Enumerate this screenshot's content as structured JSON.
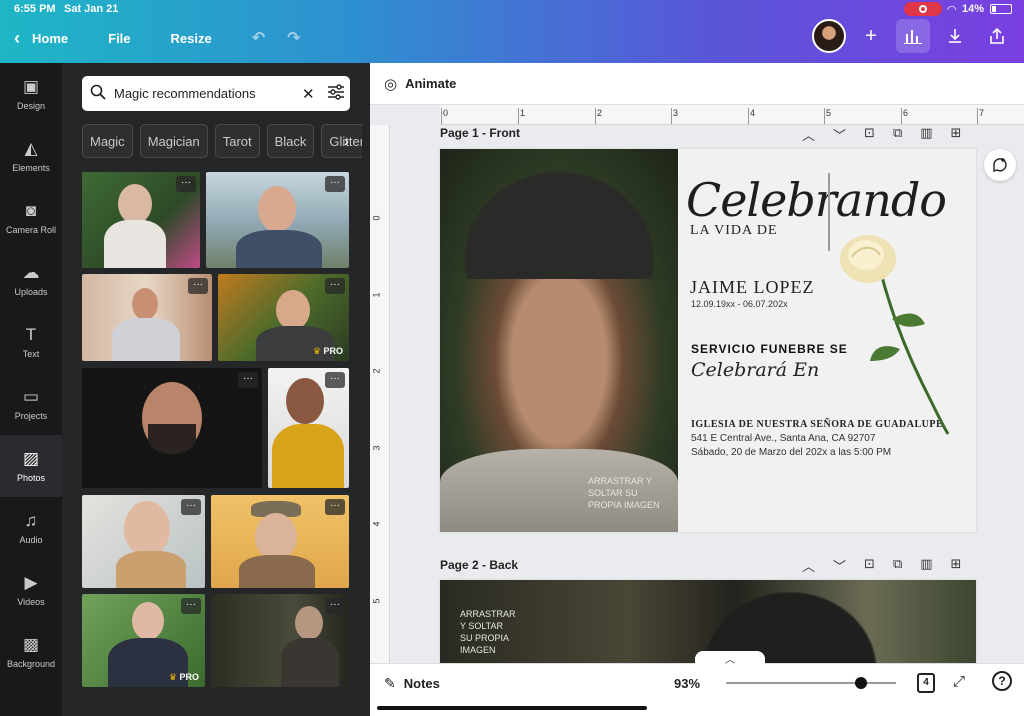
{
  "status": {
    "time": "6:55 PM",
    "date": "Sat Jan 21",
    "battery": "14%"
  },
  "nav": {
    "home": "Home",
    "file": "File",
    "resize": "Resize"
  },
  "rail": [
    {
      "label": "Design",
      "icon": "layout-icon"
    },
    {
      "label": "Elements",
      "icon": "shapes-icon"
    },
    {
      "label": "Camera Roll",
      "icon": "camera-icon"
    },
    {
      "label": "Uploads",
      "icon": "cloud-upload-icon"
    },
    {
      "label": "Text",
      "icon": "text-icon"
    },
    {
      "label": "Projects",
      "icon": "folder-icon"
    },
    {
      "label": "Photos",
      "icon": "image-icon"
    },
    {
      "label": "Audio",
      "icon": "music-icon"
    },
    {
      "label": "Videos",
      "icon": "video-icon"
    },
    {
      "label": "Background",
      "icon": "pattern-icon"
    }
  ],
  "search": {
    "value": "Magic recommendations"
  },
  "chips": [
    "Magic",
    "Magician",
    "Tarot",
    "Black",
    "Glitter"
  ],
  "thumb_badges": {
    "pro": "PRO"
  },
  "toolbar": {
    "animate": "Animate"
  },
  "ruler": {
    "h": [
      "0",
      "1",
      "2",
      "3",
      "4",
      "5",
      "6",
      "7"
    ],
    "v": [
      "0",
      "1",
      "2",
      "3",
      "4",
      "5"
    ]
  },
  "pages": [
    {
      "label": "Page 1 - Front"
    },
    {
      "label": "Page 2 - Back"
    }
  ],
  "card": {
    "celebrando": "Celebrando",
    "lavida": "LA VIDA DE",
    "name": "JAIME LOPEZ",
    "dates": "12.09.19xx - 06.07.202x",
    "service": "SERVICIO FUNEBRE SE",
    "celebrara": "Celebrará En",
    "church": "IGLESIA DE NUESTRA SEÑORA DE GUADALUPE",
    "address": "541 E Central Ave., Santa Ana, CA 92707",
    "when": "Sábado, 20 de Marzo del 202x a las 5:00 PM",
    "drag_front": "ARRASTRAR Y\nSOLTAR SU\nPROPIA IMAGEN",
    "drag_back": "ARRASTRAR\nY SOLTAR\nSU PROPIA\nIMAGEN"
  },
  "bottom": {
    "notes": "Notes",
    "zoom": "93%",
    "zoom_level": 0.93,
    "page_count": "4"
  },
  "colors": {
    "accent_start": "#1fb6c6",
    "accent_end": "#7a3fe0",
    "rail_bg": "#18191b",
    "panel_bg": "#252627"
  }
}
